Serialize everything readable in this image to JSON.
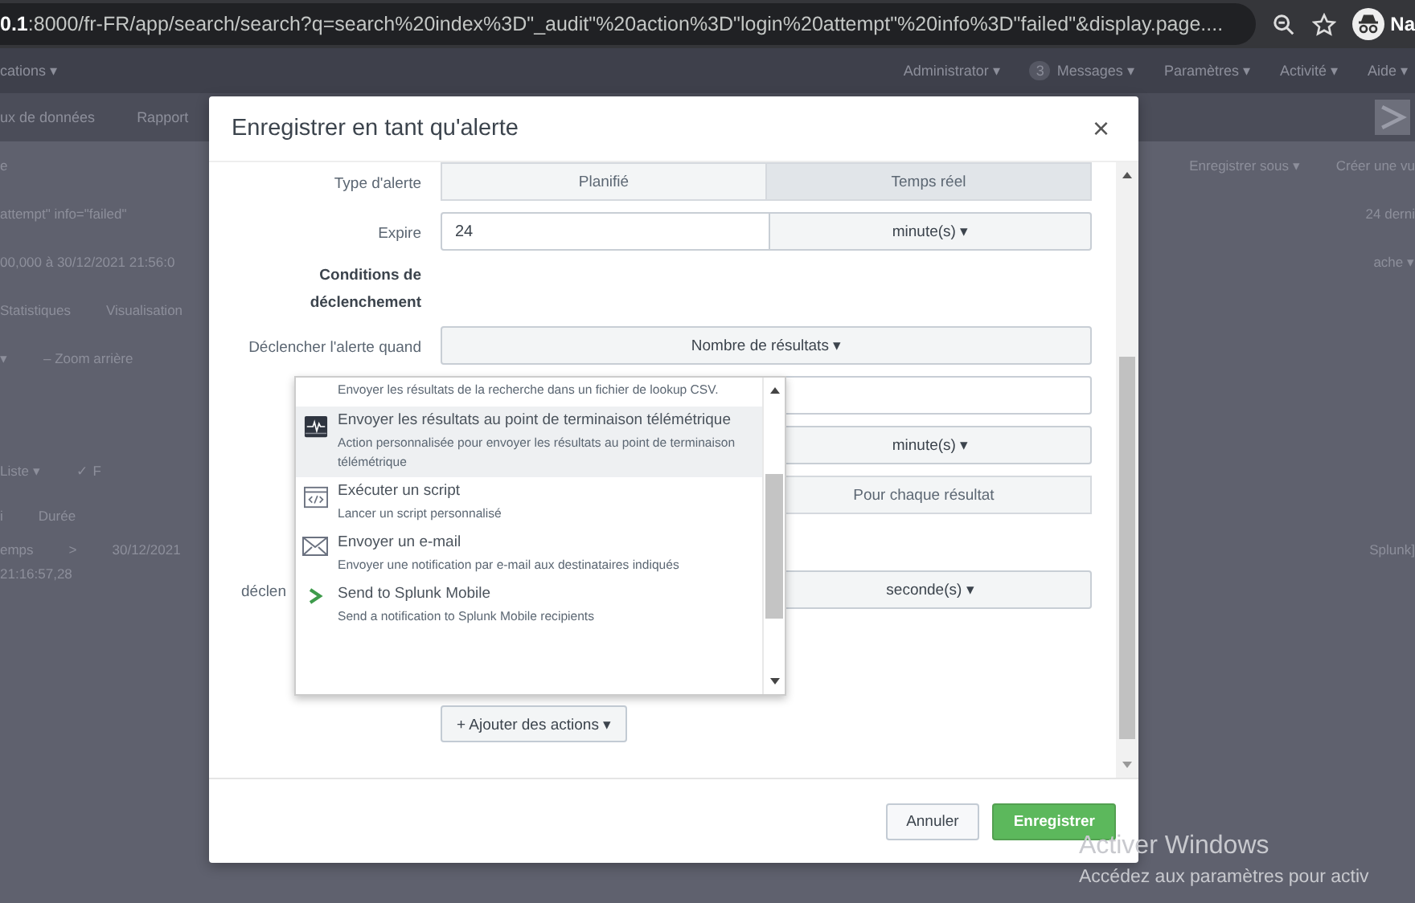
{
  "browser": {
    "url_host": "0.1",
    "url_rest": ":8000/fr-FR/app/search/search?q=search%20index%3D\"_audit\"%20action%3D\"login%20attempt\"%20info%3D\"failed\"&display.page....",
    "profile": "Na"
  },
  "app_bar": {
    "app_menu": "cations ▾",
    "items": [
      {
        "label": "Administrator ▾"
      },
      {
        "badge": "3",
        "label": "Messages ▾"
      },
      {
        "label": "Paramètres ▾"
      },
      {
        "label": "Activité ▾"
      },
      {
        "label": "Aide ▾"
      }
    ]
  },
  "app_nav": [
    "ux de données",
    "Rapport"
  ],
  "page_rows": [
    {
      "left": [
        "e"
      ],
      "right": [
        "Enregistrer sous ▾",
        "Créer une vu"
      ]
    },
    {
      "left": [
        "attempt\" info=\"failed\""
      ],
      "right": [
        "24 derni"
      ]
    },
    {
      "left": [
        "00,000 à 30/12/2021 21:56:0"
      ],
      "right": [
        "ache ▾"
      ]
    },
    {
      "left": [
        "Statistiques",
        "Visualisation"
      ]
    },
    {
      "left": [
        "▾",
        "– Zoom arrière"
      ]
    },
    {
      "left": [
        "Liste ▾",
        "✓ F"
      ]
    },
    {
      "left": [
        "i",
        "Durée"
      ]
    },
    {
      "left": [
        "emps",
        ">",
        "30/12/2021"
      ],
      "right": [
        "Splunk]"
      ]
    },
    {
      "left": [
        "21:16:57,28"
      ]
    }
  ],
  "dialog": {
    "title": "Enregistrer en tant qu'alerte",
    "close": "×",
    "rows": [
      {
        "kind": "segmented",
        "label": "Type d'alerte",
        "options": [
          {
            "label": "Planifié",
            "selected": false
          },
          {
            "label": "Temps réel",
            "selected": true
          }
        ]
      },
      {
        "kind": "input_select",
        "label": "Expire",
        "value": "24",
        "unit": "minute(s) ▾"
      },
      {
        "kind": "heading",
        "label": "Conditions de déclenchement"
      },
      {
        "kind": "select",
        "label": "Déclencher l'alerte quand",
        "value": "Nombre de résultats ▾"
      },
      {
        "kind": "input"
      },
      {
        "kind": "unit",
        "unit": "minute(s) ▾"
      },
      {
        "kind": "half_segment",
        "value": "Pour chaque résultat"
      },
      {
        "kind": "spacer"
      },
      {
        "kind": "unit_covered_label",
        "label": "déclen",
        "unit": "seconde(s) ▾"
      }
    ],
    "menu": {
      "items": [
        {
          "kind": "partial",
          "description": "Envoyer les résultats de la recherche dans un fichier de lookup CSV.",
          "selected": false
        },
        {
          "kind": "telemetry",
          "title": "Envoyer les résultats au point de terminaison télémétrique",
          "description": "Action personnalisée pour envoyer les résultats au point de terminaison télémétrique",
          "selected": true
        },
        {
          "kind": "script",
          "title": "Exécuter un script",
          "description": "Lancer un script personnalisé",
          "selected": false
        },
        {
          "kind": "email",
          "title": "Envoyer un e-mail",
          "description": "Envoyer une notification par e-mail aux destinataires indiqués",
          "selected": false
        },
        {
          "kind": "mobile",
          "title": "Send to Splunk Mobile",
          "description": "Send a notification to Splunk Mobile recipients",
          "selected": false
        }
      ]
    },
    "add_button": "+ Ajouter des actions ▾",
    "buttons": [
      {
        "label": "Annuler",
        "kind": "secondary"
      },
      {
        "label": "Enregistrer",
        "kind": "primary"
      }
    ]
  },
  "os_watermark": {
    "title": "Activer Windows",
    "subtitle": "Accédez aux paramètres pour activ"
  }
}
